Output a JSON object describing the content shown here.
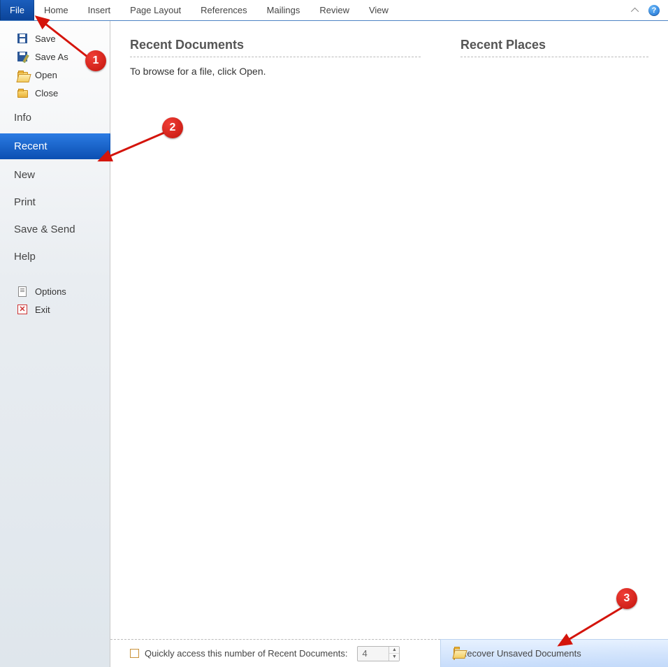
{
  "ribbon": {
    "tabs": [
      "File",
      "Home",
      "Insert",
      "Page Layout",
      "References",
      "Mailings",
      "Review",
      "View"
    ],
    "active": 0,
    "help_glyph": "?"
  },
  "sidebar": {
    "quick": [
      {
        "icon": "floppy",
        "label": "Save"
      },
      {
        "icon": "floppy-pen",
        "label": "Save As"
      },
      {
        "icon": "folder-open",
        "label": "Open"
      },
      {
        "icon": "folder",
        "label": "Close"
      }
    ],
    "sections": [
      {
        "label": "Info",
        "selected": false
      },
      {
        "label": "Recent",
        "selected": true
      },
      {
        "label": "New",
        "selected": false
      },
      {
        "label": "Print",
        "selected": false
      },
      {
        "label": "Save & Send",
        "selected": false
      },
      {
        "label": "Help",
        "selected": false
      }
    ],
    "bottom": [
      {
        "icon": "doc",
        "label": "Options"
      },
      {
        "icon": "x",
        "label": "Exit"
      }
    ]
  },
  "main": {
    "docs_heading": "Recent Documents",
    "docs_hint": "To browse for a file, click Open.",
    "places_heading": "Recent Places"
  },
  "footer": {
    "checkbox_label": "Quickly access this number of Recent Documents:",
    "checkbox_checked": false,
    "count_value": "4",
    "recover_label": "Recover Unsaved Documents"
  },
  "annotations": {
    "c1": "1",
    "c2": "2",
    "c3": "3"
  }
}
